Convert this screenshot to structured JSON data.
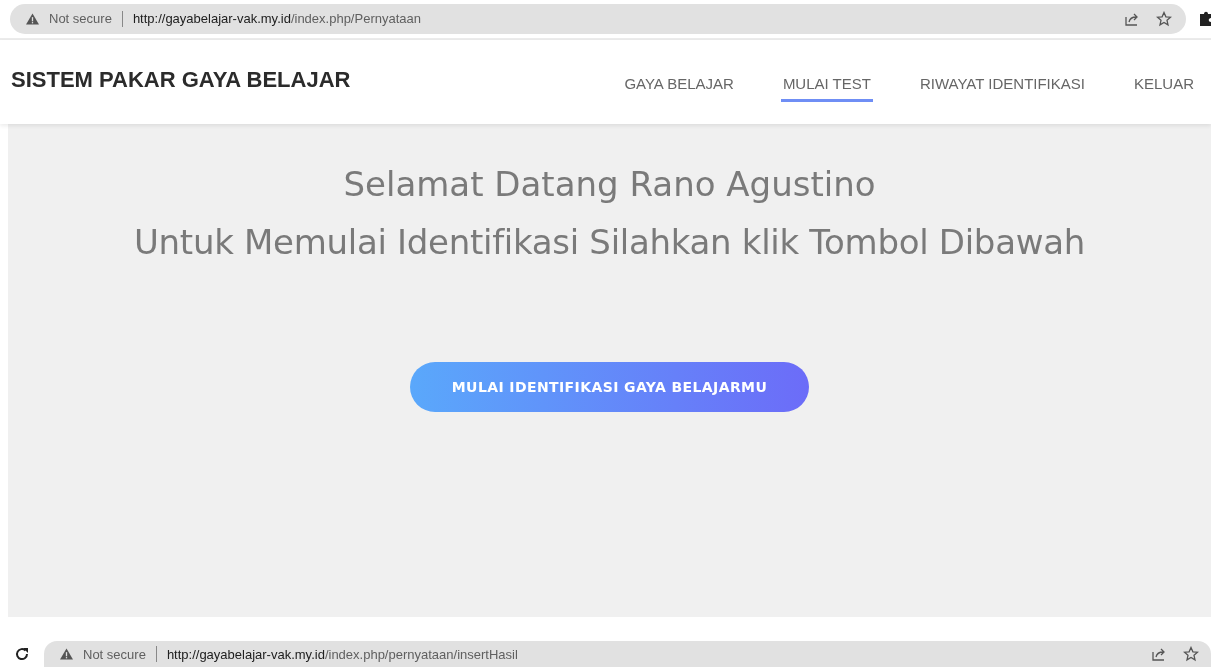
{
  "top_bar": {
    "security": "Not secure",
    "url_host": "http://gayabelajar-vak.my.id",
    "url_path": "/index.php/Pernyataan"
  },
  "header": {
    "brand": "SISTEM PAKAR GAYA BELAJAR",
    "nav": [
      {
        "label": "GAYA BELAJAR",
        "selected": false
      },
      {
        "label": "MULAI TEST",
        "selected": true
      },
      {
        "label": "RIWAYAT IDENTIFIKASI",
        "selected": false
      },
      {
        "label": "KELUAR",
        "selected": false
      }
    ]
  },
  "hero": {
    "greeting": "Selamat Datang Rano Agustino",
    "instruction": "Untuk Memulai Identifikasi Silahkan klik Tombol Dibawah",
    "button": "MULAI IDENTIFIKASI GAYA BELAJARMU"
  },
  "bottom_bar": {
    "security": "Not secure",
    "url_host": "http://gayabelajar-vak.my.id",
    "url_path": "/index.php/pernyataan/insertHasil"
  }
}
